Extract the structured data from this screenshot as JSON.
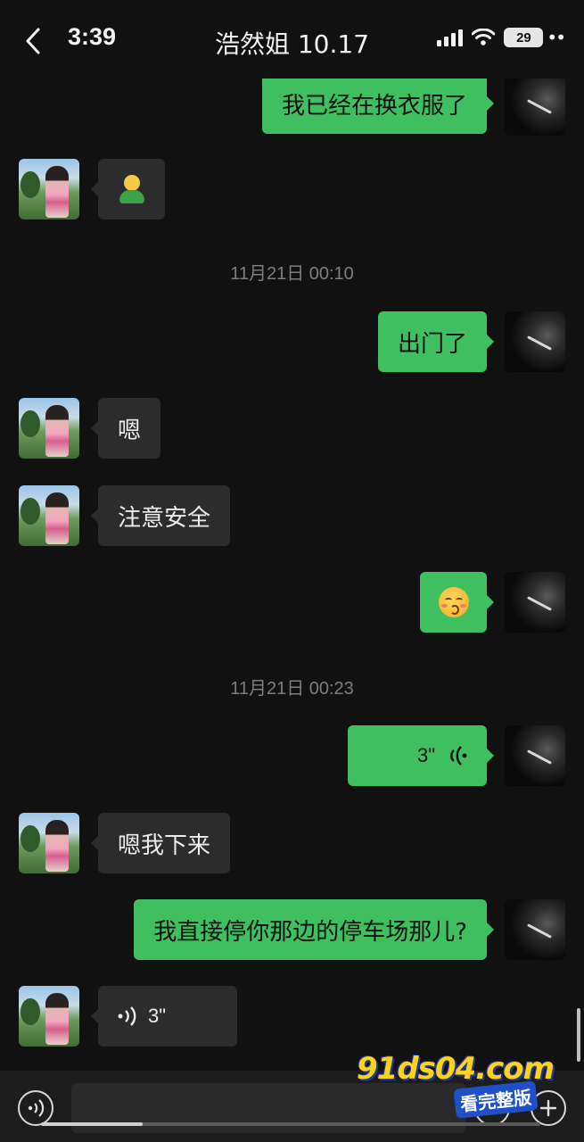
{
  "status_bar": {
    "time": "3:39",
    "battery": "29"
  },
  "header": {
    "title": "浩然姐 10.17"
  },
  "messages": {
    "m1": {
      "text": "我已经在换衣服了"
    },
    "m2": {
      "emoji": "person-emoji"
    },
    "ts1": "11月21日 00:10",
    "m3": {
      "text": "出门了"
    },
    "m4": {
      "text": "嗯"
    },
    "m5": {
      "text": "注意安全"
    },
    "m6": {
      "emoji": "kissing-face-emoji"
    },
    "ts2": "11月21日 00:23",
    "m7": {
      "duration": "3\""
    },
    "m8": {
      "text": "嗯我下来"
    },
    "m9": {
      "text": "我直接停你那边的停车场那儿?"
    },
    "m10": {
      "duration": "3\""
    }
  },
  "watermark": {
    "domain": "91ds04.com",
    "subtitle": "看完整版"
  },
  "colors": {
    "background": "#111111",
    "outgoing_bubble": "#3fbf5f",
    "incoming_bubble": "#2c2c2c",
    "timestamp": "#7e7e7e"
  },
  "icons": {
    "back": "chevron-left-icon",
    "voice_mode": "voice-icon",
    "emoji": "emoji-icon",
    "plus": "plus-icon"
  }
}
